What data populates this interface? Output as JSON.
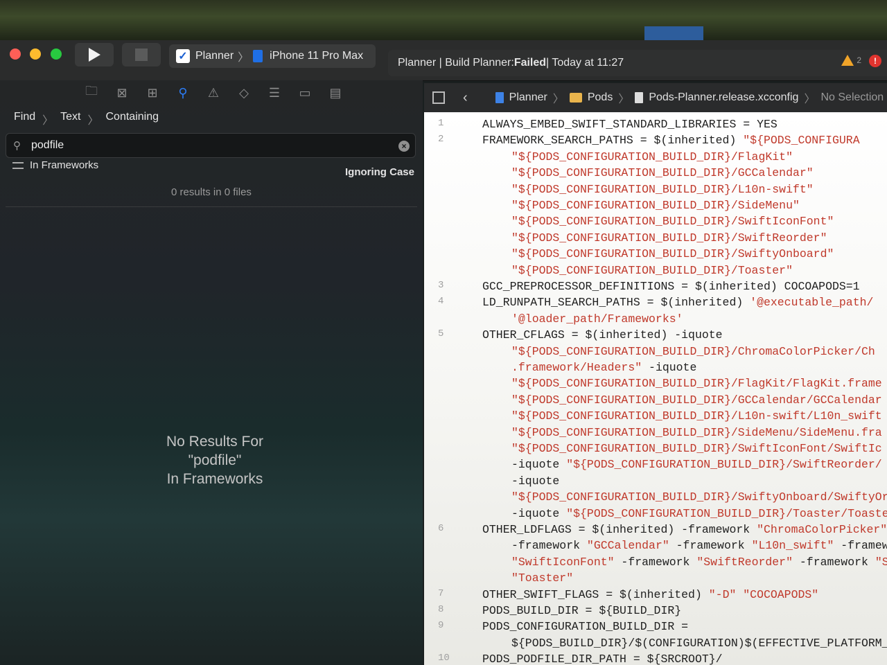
{
  "toolbar": {
    "scheme": "Planner",
    "device": "iPhone 11 Pro Max",
    "status": {
      "prefix": "Planner | Build Planner: ",
      "result": "Failed",
      "suffix": " | Today at 11:27"
    },
    "warning_count": "2",
    "error_count": "!"
  },
  "navigator": {
    "find_breadcrumb": [
      "Find",
      "Text",
      "Containing"
    ],
    "search_value": "podfile",
    "scope": "In Frameworks",
    "case_option": "Ignoring Case",
    "results_count": "0 results in 0 files",
    "no_results": [
      "No Results For",
      "\"podfile\"",
      "In Frameworks"
    ]
  },
  "editor": {
    "jumpbar": {
      "project": "Planner",
      "group": "Pods",
      "file": "Pods-Planner.release.xcconfig",
      "selection": "No Selection"
    },
    "lines": [
      {
        "n": "1",
        "segs": [
          [
            "ALWAYS_EMBED_SWIFT_STANDARD_LIBRARIES = YES",
            "t"
          ]
        ]
      },
      {
        "n": "2",
        "segs": [
          [
            "FRAMEWORK_SEARCH_PATHS = $(inherited) ",
            "t"
          ],
          [
            "\"${PODS_CONFIGURA",
            "s"
          ]
        ]
      },
      {
        "n": "",
        "indent": true,
        "segs": [
          [
            "\"${PODS_CONFIGURATION_BUILD_DIR}/FlagKit\"",
            "s"
          ]
        ]
      },
      {
        "n": "",
        "indent": true,
        "segs": [
          [
            "\"${PODS_CONFIGURATION_BUILD_DIR}/GCCalendar\"",
            "s"
          ]
        ]
      },
      {
        "n": "",
        "indent": true,
        "segs": [
          [
            "\"${PODS_CONFIGURATION_BUILD_DIR}/L10n-swift\"",
            "s"
          ]
        ]
      },
      {
        "n": "",
        "indent": true,
        "segs": [
          [
            "\"${PODS_CONFIGURATION_BUILD_DIR}/SideMenu\"",
            "s"
          ]
        ]
      },
      {
        "n": "",
        "indent": true,
        "segs": [
          [
            "\"${PODS_CONFIGURATION_BUILD_DIR}/SwiftIconFont\"",
            "s"
          ]
        ]
      },
      {
        "n": "",
        "indent": true,
        "segs": [
          [
            "\"${PODS_CONFIGURATION_BUILD_DIR}/SwiftReorder\"",
            "s"
          ]
        ]
      },
      {
        "n": "",
        "indent": true,
        "segs": [
          [
            "\"${PODS_CONFIGURATION_BUILD_DIR}/SwiftyOnboard\"",
            "s"
          ]
        ]
      },
      {
        "n": "",
        "indent": true,
        "segs": [
          [
            "\"${PODS_CONFIGURATION_BUILD_DIR}/Toaster\"",
            "s"
          ]
        ]
      },
      {
        "n": "3",
        "segs": [
          [
            "GCC_PREPROCESSOR_DEFINITIONS = $(inherited) COCOAPODS=1",
            "t"
          ]
        ]
      },
      {
        "n": "4",
        "segs": [
          [
            "LD_RUNPATH_SEARCH_PATHS = $(inherited) ",
            "t"
          ],
          [
            "'@executable_path/",
            "s"
          ]
        ]
      },
      {
        "n": "",
        "indent": true,
        "segs": [
          [
            "'@loader_path/Frameworks'",
            "s"
          ]
        ]
      },
      {
        "n": "5",
        "segs": [
          [
            "OTHER_CFLAGS = $(inherited) -iquote",
            "t"
          ]
        ]
      },
      {
        "n": "",
        "indent": true,
        "segs": [
          [
            "\"${PODS_CONFIGURATION_BUILD_DIR}/ChromaColorPicker/Ch",
            "s"
          ]
        ]
      },
      {
        "n": "",
        "indent": true,
        "segs": [
          [
            ".framework/Headers\"",
            "s"
          ],
          [
            " -iquote",
            "t"
          ]
        ]
      },
      {
        "n": "",
        "indent": true,
        "segs": [
          [
            "\"${PODS_CONFIGURATION_BUILD_DIR}/FlagKit/FlagKit.frame",
            "s"
          ]
        ]
      },
      {
        "n": "",
        "indent": true,
        "segs": [
          [
            "\"${PODS_CONFIGURATION_BUILD_DIR}/GCCalendar/GCCalendar",
            "s"
          ]
        ]
      },
      {
        "n": "",
        "indent": true,
        "segs": [
          [
            "\"${PODS_CONFIGURATION_BUILD_DIR}/L10n-swift/L10n_swift",
            "s"
          ]
        ]
      },
      {
        "n": "",
        "indent": true,
        "segs": [
          [
            "\"${PODS_CONFIGURATION_BUILD_DIR}/SideMenu/SideMenu.fra",
            "s"
          ]
        ]
      },
      {
        "n": "",
        "indent": true,
        "segs": [
          [
            "\"${PODS_CONFIGURATION_BUILD_DIR}/SwiftIconFont/SwiftIc",
            "s"
          ]
        ]
      },
      {
        "n": "",
        "indent": true,
        "segs": [
          [
            "-iquote ",
            "t"
          ],
          [
            "\"${PODS_CONFIGURATION_BUILD_DIR}/SwiftReorder/",
            "s"
          ]
        ]
      },
      {
        "n": "",
        "indent": true,
        "segs": [
          [
            "-iquote",
            "t"
          ]
        ]
      },
      {
        "n": "",
        "indent": true,
        "segs": [
          [
            "\"${PODS_CONFIGURATION_BUILD_DIR}/SwiftyOnboard/SwiftyOr",
            "s"
          ]
        ]
      },
      {
        "n": "",
        "indent": true,
        "segs": [
          [
            "-iquote ",
            "t"
          ],
          [
            "\"${PODS_CONFIGURATION_BUILD_DIR}/Toaster/Toaste",
            "s"
          ]
        ]
      },
      {
        "n": "6",
        "segs": [
          [
            "OTHER_LDFLAGS = $(inherited) -framework ",
            "t"
          ],
          [
            "\"ChromaColorPicker\"",
            "s"
          ]
        ]
      },
      {
        "n": "",
        "indent": true,
        "segs": [
          [
            "-framework ",
            "t"
          ],
          [
            "\"GCCalendar\"",
            "s"
          ],
          [
            " -framework ",
            "t"
          ],
          [
            "\"L10n_swift\"",
            "s"
          ],
          [
            " -framew",
            "t"
          ]
        ]
      },
      {
        "n": "",
        "indent": true,
        "segs": [
          [
            "\"SwiftIconFont\"",
            "s"
          ],
          [
            " -framework ",
            "t"
          ],
          [
            "\"SwiftReorder\"",
            "s"
          ],
          [
            " -framework ",
            "t"
          ],
          [
            "\"S",
            "s"
          ]
        ]
      },
      {
        "n": "",
        "indent": true,
        "segs": [
          [
            "\"Toaster\"",
            "s"
          ]
        ]
      },
      {
        "n": "7",
        "segs": [
          [
            "OTHER_SWIFT_FLAGS = $(inherited) ",
            "t"
          ],
          [
            "\"-D\" \"COCOAPODS\"",
            "s"
          ]
        ]
      },
      {
        "n": "8",
        "segs": [
          [
            "PODS_BUILD_DIR = ${BUILD_DIR}",
            "t"
          ]
        ]
      },
      {
        "n": "9",
        "segs": [
          [
            "PODS_CONFIGURATION_BUILD_DIR =",
            "t"
          ]
        ]
      },
      {
        "n": "",
        "indent": true,
        "segs": [
          [
            "${PODS_BUILD_DIR}/$(CONFIGURATION)$(EFFECTIVE_PLATFORM_N",
            "t"
          ]
        ]
      },
      {
        "n": "10",
        "segs": [
          [
            "PODS_PODFILE_DIR_PATH = ${SRCROOT}/",
            "t"
          ]
        ]
      }
    ]
  }
}
